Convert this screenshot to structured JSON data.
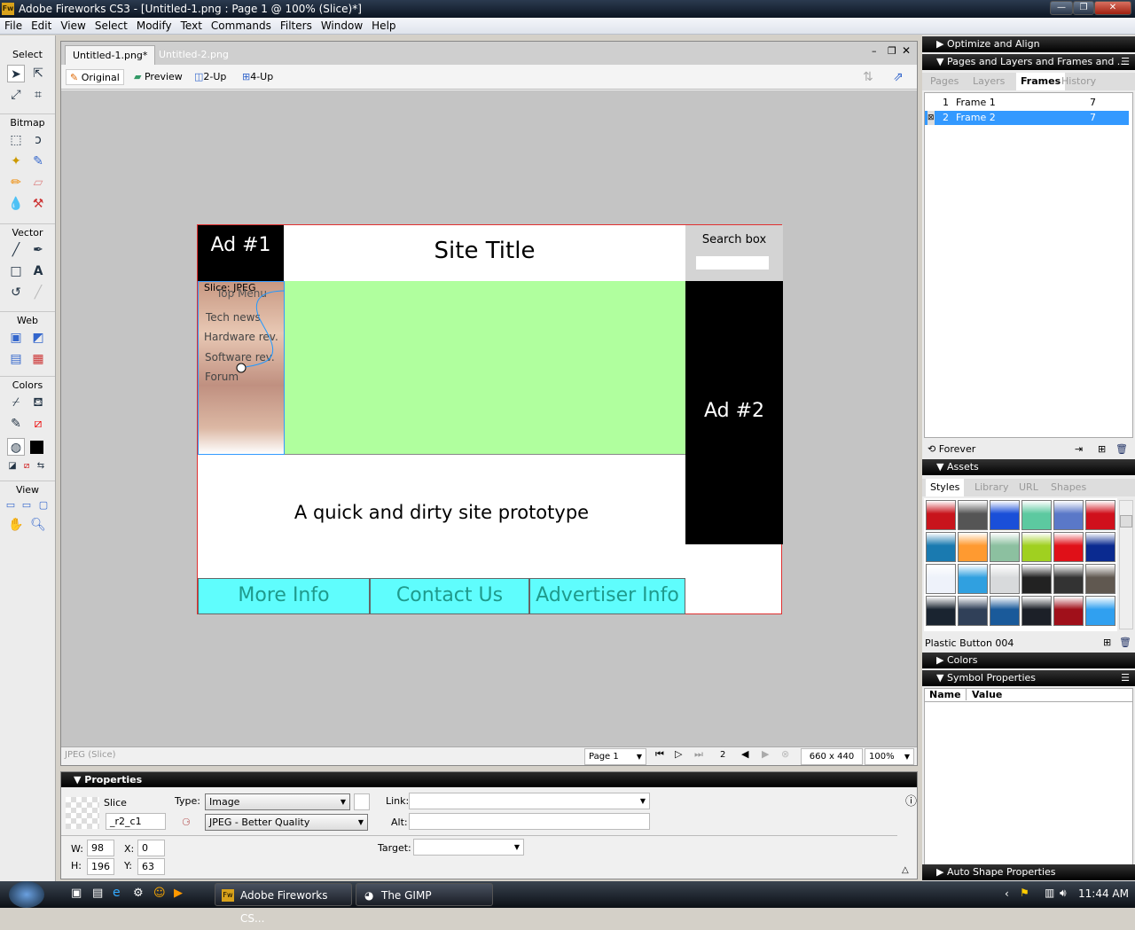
{
  "window": {
    "title": "Adobe Fireworks CS3 - [Untitled-1.png : Page 1 @ 100% (Slice)*]",
    "app_badge": "Fw"
  },
  "menu": [
    "File",
    "Edit",
    "View",
    "Select",
    "Modify",
    "Text",
    "Commands",
    "Filters",
    "Window",
    "Help"
  ],
  "tools": {
    "sections": [
      "Select",
      "Bitmap",
      "Vector",
      "Web",
      "Colors",
      "View"
    ]
  },
  "document": {
    "tabs": [
      "Untitled-1.png*",
      "Untitled-2.png"
    ],
    "view_buttons": [
      "Original",
      "Preview",
      "2-Up",
      "4-Up"
    ],
    "status_left": "JPEG (Slice)",
    "page_select": "Page 1",
    "frame_number": "2",
    "canvas_size": "660 x 440",
    "zoom": "100%"
  },
  "design": {
    "ad1": "Ad #1",
    "site_title": "Site Title",
    "search_label": "Search box",
    "slice_label": "Slice: JPEG",
    "menu_items": [
      "Top Menu",
      "Tech news",
      "Hardware rev.",
      "Software rev.",
      "Forum"
    ],
    "ad2": "Ad #2",
    "tagline": "A quick and dirty site prototype",
    "footer": [
      "More Info",
      "Contact Us",
      "Advertiser Info"
    ],
    "colors": {
      "green": "#b0ff9e",
      "cyan": "#5ffdfd",
      "footer_text": "#1f9a8c",
      "border": "#e03030"
    }
  },
  "properties": {
    "title": "Properties",
    "object_type": "Slice",
    "name": "_r2_c1",
    "type_label": "Type:",
    "type_value": "Image",
    "format_value": "JPEG - Better Quality",
    "link_label": "Link:",
    "alt_label": "Alt:",
    "target_label": "Target:",
    "w_label": "W:",
    "w": "98",
    "h_label": "H:",
    "h": "196",
    "x_label": "X:",
    "x": "0",
    "y_label": "Y:",
    "y": "63"
  },
  "panels": {
    "optimize": "Optimize and Align",
    "pages_layers": "Pages and Layers and Frames and ...",
    "pl_tabs": [
      "Pages",
      "Layers",
      "Frames",
      "History"
    ],
    "frames": [
      {
        "num": "1",
        "name": "Frame 1",
        "delay": "7"
      },
      {
        "num": "2",
        "name": "Frame 2",
        "delay": "7"
      }
    ],
    "loop": "Forever",
    "assets": "Assets",
    "asset_tabs": [
      "Styles",
      "Library",
      "URL",
      "Shapes"
    ],
    "styles": [
      "#c8141c",
      "#555555",
      "#1a4fd8",
      "#5cc9a0",
      "#5a78c8",
      "#d0101c",
      "#1a7ab0",
      "#ff9a30",
      "#8cc0a0",
      "#a0d020",
      "#e01018",
      "#0a2a90",
      "#eef2fa",
      "#30a0e0",
      "#d8dadc",
      "#222222",
      "#333333",
      "#605850",
      "#1a2430",
      "#304058",
      "#1a5a9a",
      "#1c2028",
      "#a0101a",
      "#30a0f0"
    ],
    "selected_style": "Plastic Button 004",
    "colors": "Colors",
    "symbol_props": "Symbol Properties",
    "sym_cols": [
      "Name",
      "Value"
    ],
    "auto_shape": "Auto Shape Properties"
  },
  "taskbar": {
    "items": [
      "Adobe Fireworks CS...",
      "The GIMP"
    ],
    "clock": "11:44 AM"
  }
}
